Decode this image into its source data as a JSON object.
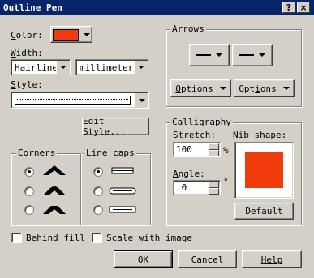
{
  "window": {
    "title": "Outline Pen"
  },
  "title_buttons": {
    "help": "?",
    "close": "×"
  },
  "color": {
    "label_u": "C",
    "label_rest": "olor:",
    "value": "#f03c0c"
  },
  "width": {
    "label_u": "W",
    "label_rest": "idth:",
    "value": "Hairline",
    "units": "millimeters"
  },
  "style": {
    "label_u": "S",
    "label_rest": "tyle:"
  },
  "edit_style": {
    "label": "Edit Style..."
  },
  "arrows": {
    "title": "Arrows",
    "options_left_u": "O",
    "options_left_rest": "ptions",
    "options_right_pre": "Opt",
    "options_right_u": "i",
    "options_right_rest": "ons"
  },
  "corners": {
    "title": "Corners",
    "selected": 0
  },
  "line_caps": {
    "title": "Line caps",
    "selected": 0
  },
  "calligraphy": {
    "title": "Calligraphy",
    "stretch_label_pre": "St",
    "stretch_label_u": "r",
    "stretch_label_rest": "etch:",
    "stretch_value": "100",
    "stretch_unit": "%",
    "angle_label_u": "A",
    "angle_label_rest": "ngle:",
    "angle_value": ".0",
    "angle_unit": "°",
    "nib_label": "Nib shape:",
    "nib_color": "#f03c0c",
    "default_label": "Default"
  },
  "behind_fill": {
    "label_u": "B",
    "label_rest": "ehind fill"
  },
  "scale_with_image": {
    "label_pre": "Scale with ",
    "label_u": "i",
    "label_rest": "mage"
  },
  "buttons": {
    "ok": "OK",
    "cancel": "Cancel",
    "help": "Help"
  }
}
